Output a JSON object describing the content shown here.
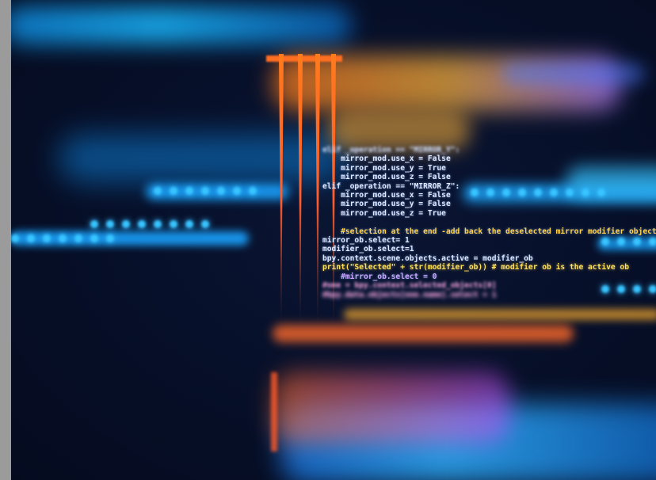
{
  "image": {
    "kind": "blurred source code with light streaks",
    "colors": {
      "background": "#050b1f",
      "blue_glow": "#1aa3ff",
      "orange_glow": "#ff7b1c",
      "code_text": "#dfe9ff",
      "highlight_yellow": "#ffe15a"
    }
  },
  "code": {
    "lines": [
      "elif _operation == \"MIRROR_Y\":",
      "    mirror_mod.use_x = False",
      "    mirror_mod.use_y = True",
      "    mirror_mod.use_z = False",
      "elif _operation == \"MIRROR_Z\":",
      "    mirror_mod.use_x = False",
      "    mirror_mod.use_y = False",
      "    mirror_mod.use_z = True",
      "",
      "    #selection at the end -add back the deselected mirror modifier object",
      "mirror_ob.select= 1",
      "modifier_ob.select=1",
      "bpy.context.scene.objects.active = modifier_ob",
      "print(\"Selected\" + str(modifier_ob)) # modifier ob is the active ob",
      "    #mirror_ob.select = 0",
      "#ome = bpy.context.selected_objects[0]",
      "#bpy.data.objects[one.name].select = 1"
    ]
  }
}
